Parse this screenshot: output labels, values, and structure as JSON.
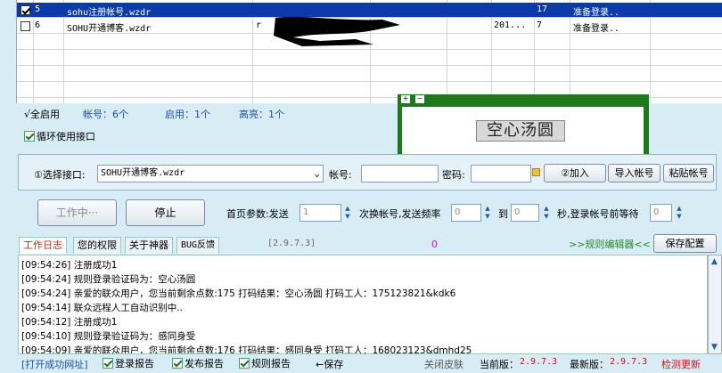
{
  "grid": {
    "rows": [
      {
        "checked": true,
        "num": "5",
        "name": "sohu注册帐号.wzdr",
        "col3": "",
        "col5": "",
        "count": "17",
        "status": "准备登录..",
        "selected": true
      },
      {
        "checked": false,
        "num": "6",
        "name": "SOHU开通博客.wzdr",
        "col3": "r",
        "col5": "201...",
        "count": "7",
        "status": "准备登录..",
        "selected": false
      }
    ]
  },
  "summary": {
    "all_enabled": "√全启用",
    "accounts": "帐号：6个",
    "enabled": "启用：1个",
    "highlighted": "高亮：1个"
  },
  "loop_interface": "循环使用接口",
  "captcha": {
    "plus": "+",
    "minus": "−",
    "text": "空心汤圆"
  },
  "form": {
    "select_interface_label": "①选择接口:",
    "interface_value": "SOHU开通博客.wzdr",
    "dropdown_arrow": "⌄",
    "account_label": "帐号:",
    "account_value": "",
    "password_label": "密码:",
    "password_value": "",
    "add_button": "②加入",
    "import_button": "导入帐号",
    "paste_button": "粘贴帐号"
  },
  "controls": {
    "working_button": "工作中···",
    "stop_button": "停止",
    "homepage_params": "首页参数:发送",
    "send_value": "1",
    "switch_label": "次换帐号,发送频率",
    "freq_from": "0",
    "to_label": "到",
    "freq_to": "0",
    "wait_label": "秒,登录帐号前等待",
    "wait_value": "0"
  },
  "tabs": [
    {
      "label": "工作日志",
      "active": true
    },
    {
      "label": "您的权限",
      "active": false
    },
    {
      "label": "关于神器",
      "active": false
    },
    {
      "label": "BUG反馈",
      "active": false
    }
  ],
  "version_tag": "[2.9.7.3]",
  "zero_counter": "0",
  "rule_editor": ">>规则编辑器<<",
  "save_config": "保存配置",
  "log": [
    "[09:54:26] 注册成功1",
    "[09:54:24] 规则登录验证码为：空心汤圆",
    "[09:54:24] 亲爱的联众用户，您当前剩余点数:175 打码结果：空心汤圆 打码工人：175123821&kdk6",
    "[09:54:14] 联众远程人工自动识别中..",
    "[09:54:12] 注册成功1",
    "[09:54:10] 规则登录验证码为：感同身受",
    "[09:54:09] 亲爱的联众用户，您当前剩余点数:176 打码结果：感同身受 打码工人：168023123&dmhd25"
  ],
  "status_bar": {
    "open_success_url": "[打开成功网址]",
    "login_report": "登录报告",
    "publish_report": "发布报告",
    "rule_report": "规则报告",
    "save": "保存",
    "close_skin": "关闭皮肤",
    "current_version_label": "当前版：",
    "current_version": "2.9.7.3",
    "latest_version_label": "最新版：",
    "latest_version": "2.9.7.3",
    "check_update": "检测更新"
  }
}
